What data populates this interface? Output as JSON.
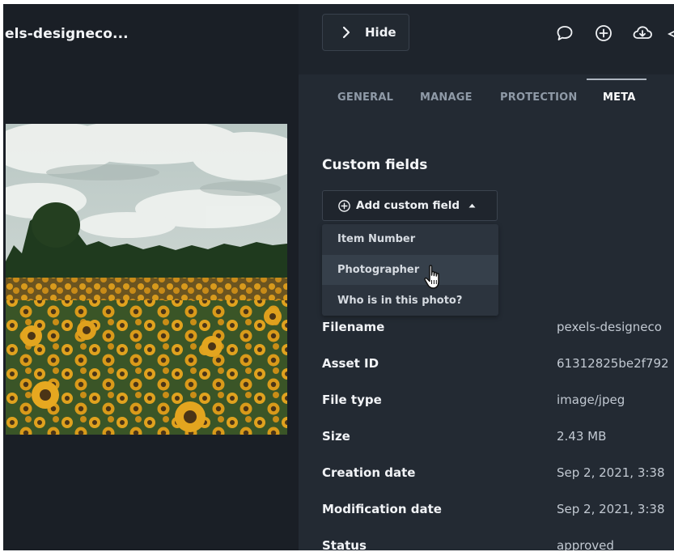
{
  "asset": {
    "title": "els-designeco..."
  },
  "toolbar": {
    "hide_label": "Hide",
    "icons": [
      "comment-icon",
      "add-circle-icon",
      "cloud-download-icon",
      "share-icon"
    ]
  },
  "tabs": [
    {
      "label": "GENERAL",
      "active": false
    },
    {
      "label": "MANAGE",
      "active": false
    },
    {
      "label": "PROTECTION",
      "active": false
    },
    {
      "label": "META",
      "active": true
    }
  ],
  "custom_fields": {
    "title": "Custom fields",
    "add_label": "Add custom field",
    "options": [
      "Item Number",
      "Photographer",
      "Who is in this photo?"
    ],
    "hovered_option": "Photographer"
  },
  "meta": [
    {
      "label": "Filename",
      "value": "pexels-designeco"
    },
    {
      "label": "Asset ID",
      "value": "61312825be2f792"
    },
    {
      "label": "File type",
      "value": "image/jpeg"
    },
    {
      "label": "Size",
      "value": "2.43 MB"
    },
    {
      "label": "Creation date",
      "value": "Sep 2, 2021, 3:38"
    },
    {
      "label": "Modification date",
      "value": "Sep 2, 2021, 3:38"
    },
    {
      "label": "Status",
      "value": "approved"
    }
  ],
  "colors": {
    "left_bg": "#1a1f26",
    "panel_bg": "#232a33",
    "dropdown_bg": "#2c343e",
    "dropdown_hover": "#36404b"
  }
}
